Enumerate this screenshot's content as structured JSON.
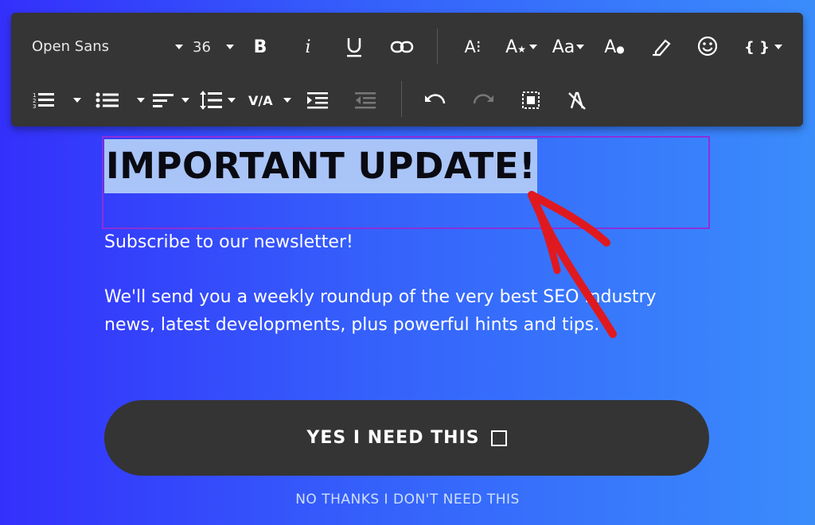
{
  "toolbar": {
    "font_family": "Open Sans",
    "font_size": "36",
    "italic_label": "i",
    "letter_spacing_label": "V/A",
    "text_case_label": "Aa",
    "code_label": "{ }"
  },
  "content": {
    "headline": "IMPORTANT UPDATE!",
    "subtitle": "Subscribe to our newsletter!",
    "body": "We'll send you a weekly roundup of the very best SEO industry news, latest developments, plus powerful hints and tips.",
    "cta_label": "YES I NEED THIS",
    "decline_label": "NO THANKS I DON'T NEED THIS"
  },
  "colors": {
    "toolbar_bg": "#353535",
    "selection": "#a9c4f7",
    "selection_border": "#8b2fd9",
    "cta_bg": "#343434",
    "annotation_arrow": "#e0191f"
  },
  "icons": [
    "bold-icon",
    "italic-icon",
    "underline-icon",
    "link-icon",
    "font-size-icon",
    "text-effect-icon",
    "text-case-icon",
    "text-color-icon",
    "highlight-icon",
    "emoji-icon",
    "code-icon",
    "ordered-list-icon",
    "unordered-list-icon",
    "align-icon",
    "line-height-icon",
    "letter-spacing-icon",
    "indent-icon",
    "outdent-icon",
    "undo-icon",
    "redo-icon",
    "select-all-icon",
    "clear-format-icon"
  ]
}
